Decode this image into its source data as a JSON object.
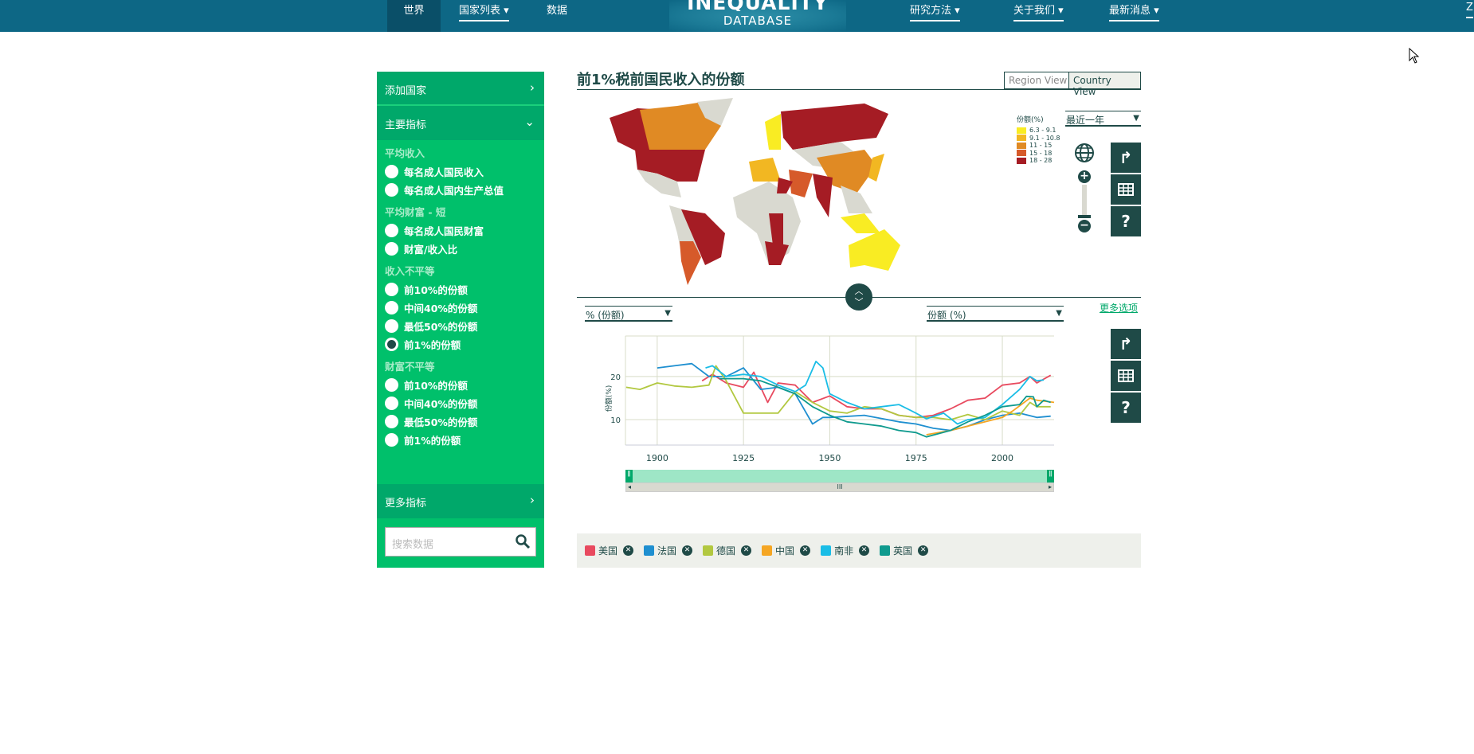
{
  "nav": {
    "items": [
      {
        "label": "世界"
      },
      {
        "label": "国家列表"
      },
      {
        "label": "数据"
      },
      {
        "label": "研究方法"
      },
      {
        "label": "关于我们"
      },
      {
        "label": "最新消息"
      }
    ],
    "logo_top": "INEQUALITY",
    "logo_bottom": "DATABASE",
    "right_label": "Z"
  },
  "sidebar": {
    "add_country": "添加国家",
    "main_indicators": "主要指标",
    "more_indicators": "更多指标",
    "search_placeholder": "搜索数据",
    "groups": [
      {
        "label": "平均收入",
        "items": [
          {
            "label": "每名成人国民收入",
            "selected": false
          },
          {
            "label": "每名成人国内生产总值",
            "selected": false
          }
        ]
      },
      {
        "label": "平均财富 - 短",
        "items": [
          {
            "label": "每名成人国民财富",
            "selected": false
          },
          {
            "label": "财富/收入比",
            "selected": false
          }
        ]
      },
      {
        "label": "收入不平等",
        "items": [
          {
            "label": "前10%的份额",
            "selected": false
          },
          {
            "label": "中间40%的份额",
            "selected": false
          },
          {
            "label": "最低50%的份额",
            "selected": false
          },
          {
            "label": "前1%的份额",
            "selected": true
          }
        ]
      },
      {
        "label": "财富不平等",
        "items": [
          {
            "label": "前10%的份额",
            "selected": false
          },
          {
            "label": "中间40%的份额",
            "selected": false
          },
          {
            "label": "最低50%的份额",
            "selected": false
          },
          {
            "label": "前1%的份额",
            "selected": false
          }
        ]
      }
    ]
  },
  "main": {
    "title": "前1%税前国民收入的份额",
    "region_view": "Region View",
    "country_view": "Country View",
    "map_legend": {
      "title": "份额(%)",
      "bins": [
        {
          "label": "6.3 - 9.1",
          "color": "#f9ec23"
        },
        {
          "label": "9.1 - 10.8",
          "color": "#f2b722"
        },
        {
          "label": "11 - 15",
          "color": "#e08a24"
        },
        {
          "label": "15 - 18",
          "color": "#d65a2a"
        },
        {
          "label": "18 - 28",
          "color": "#a51c24"
        }
      ]
    },
    "year_select": "最近一年",
    "unit_select": "% (份额)",
    "variable_select": "份额 (%)",
    "more_options": "更多选项"
  },
  "chart_data": {
    "type": "line",
    "ylabel": "份额(%)",
    "xlim": [
      1890.8,
      2015
    ],
    "ylim": [
      4.1,
      29.4
    ],
    "xticks": [
      1900,
      1925,
      1950,
      1975,
      2000
    ],
    "yticks": [
      10,
      20
    ],
    "grid": true,
    "series": [
      {
        "name": "美国",
        "color": "#e84a5f",
        "points": [
          [
            1913,
            19
          ],
          [
            1916,
            20.5
          ],
          [
            1920,
            18.5
          ],
          [
            1925,
            17.5
          ],
          [
            1928,
            21
          ],
          [
            1932,
            14
          ],
          [
            1935,
            18.5
          ],
          [
            1940,
            18
          ],
          [
            1945,
            14
          ],
          [
            1950,
            15.5
          ],
          [
            1955,
            13
          ],
          [
            1960,
            12.5
          ],
          [
            1965,
            12.5
          ],
          [
            1970,
            11
          ],
          [
            1975,
            10.5
          ],
          [
            1980,
            11
          ],
          [
            1985,
            12.5
          ],
          [
            1990,
            14.5
          ],
          [
            1995,
            15
          ],
          [
            2000,
            18
          ],
          [
            2005,
            18.5
          ],
          [
            2008,
            20
          ],
          [
            2010,
            18.5
          ],
          [
            2014,
            20.3
          ]
        ]
      },
      {
        "name": "法国",
        "color": "#1e8fd0",
        "points": [
          [
            1900,
            22
          ],
          [
            1905,
            22.5
          ],
          [
            1910,
            23
          ],
          [
            1915,
            20
          ],
          [
            1920,
            20
          ],
          [
            1925,
            22
          ],
          [
            1930,
            17
          ],
          [
            1935,
            17.5
          ],
          [
            1940,
            16
          ],
          [
            1945,
            9
          ],
          [
            1948,
            10.5
          ],
          [
            1950,
            10.5
          ],
          [
            1960,
            11
          ],
          [
            1970,
            9.5
          ],
          [
            1975,
            9
          ],
          [
            1980,
            8
          ],
          [
            1985,
            7.5
          ],
          [
            1990,
            8.5
          ],
          [
            1995,
            10
          ],
          [
            2000,
            11
          ],
          [
            2005,
            11.5
          ],
          [
            2010,
            10.5
          ],
          [
            2014,
            10.8
          ]
        ]
      },
      {
        "name": "德国",
        "color": "#b2c840",
        "points": [
          [
            1891,
            17.5
          ],
          [
            1895,
            17
          ],
          [
            1900,
            18.5
          ],
          [
            1905,
            17.8
          ],
          [
            1910,
            17.5
          ],
          [
            1915,
            18
          ],
          [
            1917,
            22.5
          ],
          [
            1920,
            19
          ],
          [
            1925,
            11.5
          ],
          [
            1930,
            11.5
          ],
          [
            1935,
            11.5
          ],
          [
            1940,
            16.5
          ],
          [
            1945,
            14
          ],
          [
            1950,
            12
          ],
          [
            1955,
            11.5
          ],
          [
            1960,
            13
          ],
          [
            1965,
            12.5
          ],
          [
            1970,
            11
          ],
          [
            1975,
            10.5
          ],
          [
            1980,
            10.5
          ],
          [
            1985,
            10
          ],
          [
            1990,
            11.2
          ],
          [
            1995,
            10
          ],
          [
            2000,
            12
          ],
          [
            2005,
            11
          ],
          [
            2008,
            14
          ],
          [
            2010,
            13
          ],
          [
            2014,
            13
          ]
        ]
      },
      {
        "name": "中国",
        "color": "#f5a623",
        "points": [
          [
            1978,
            6.5
          ],
          [
            1985,
            7.5
          ],
          [
            1990,
            8.5
          ],
          [
            1995,
            9.5
          ],
          [
            2000,
            10.5
          ],
          [
            2003,
            12
          ],
          [
            2008,
            15
          ],
          [
            2010,
            14.5
          ],
          [
            2015,
            14
          ]
        ]
      },
      {
        "name": "南非",
        "color": "#1abde6",
        "points": [
          [
            1914,
            22
          ],
          [
            1916,
            22.5
          ],
          [
            1920,
            20
          ],
          [
            1925,
            20.5
          ],
          [
            1930,
            20
          ],
          [
            1935,
            18
          ],
          [
            1940,
            16.5
          ],
          [
            1943,
            18
          ],
          [
            1946,
            23.5
          ],
          [
            1948,
            22
          ],
          [
            1950,
            16
          ],
          [
            1955,
            14
          ],
          [
            1960,
            12.5
          ],
          [
            1965,
            13
          ],
          [
            1970,
            13.5
          ],
          [
            1975,
            11.5
          ],
          [
            1978,
            10.2
          ],
          [
            1983,
            11.5
          ],
          [
            1987,
            9
          ],
          [
            1990,
            10
          ],
          [
            1995,
            10.5
          ],
          [
            2000,
            13.5
          ],
          [
            2005,
            17
          ],
          [
            2008,
            20
          ],
          [
            2010,
            19
          ],
          [
            2012,
            19.2
          ]
        ]
      },
      {
        "name": "英国",
        "color": "#0f9a8e",
        "points": [
          [
            1918,
            19.5
          ],
          [
            1925,
            19.5
          ],
          [
            1930,
            19
          ],
          [
            1935,
            17.5
          ],
          [
            1940,
            16
          ],
          [
            1945,
            13
          ],
          [
            1950,
            11
          ],
          [
            1955,
            9.5
          ],
          [
            1960,
            9
          ],
          [
            1965,
            8.5
          ],
          [
            1970,
            7.5
          ],
          [
            1975,
            7
          ],
          [
            1978,
            6
          ],
          [
            1985,
            7.5
          ],
          [
            1990,
            9.5
          ],
          [
            1995,
            11
          ],
          [
            2000,
            13
          ],
          [
            2005,
            13.5
          ],
          [
            2007,
            15.4
          ],
          [
            2009,
            15.3
          ],
          [
            2010,
            13
          ],
          [
            2012,
            14.5
          ],
          [
            2014,
            14
          ]
        ]
      }
    ]
  }
}
